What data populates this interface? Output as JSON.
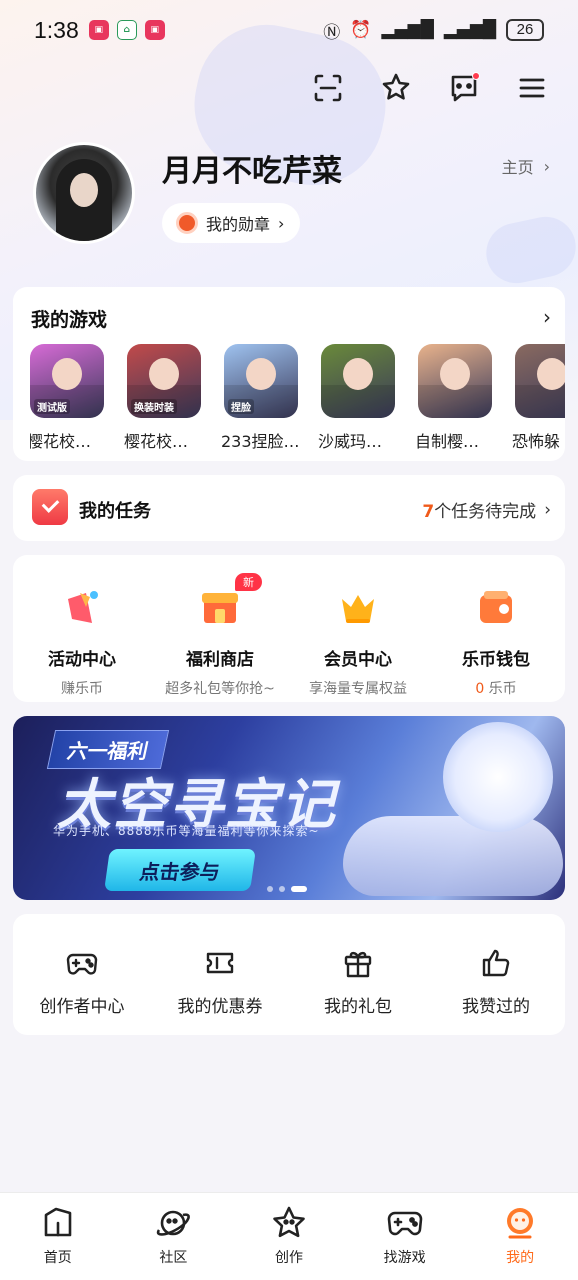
{
  "status_bar": {
    "time": "1:38",
    "battery": "26"
  },
  "profile": {
    "username": "月月不吃芹菜",
    "homepage_label": "主页",
    "medal_label": "我的勋章"
  },
  "my_games": {
    "title": "我的游戏",
    "games": [
      {
        "name": "樱花校…",
        "color": "#d76bd6",
        "tag": "测试版"
      },
      {
        "name": "樱花校…",
        "color": "#c24a4a",
        "tag": "换装时装"
      },
      {
        "name": "233捏脸…",
        "color": "#9fc3f0",
        "tag": "捏脸"
      },
      {
        "name": "沙威玛…",
        "color": "#6a8a3a",
        "tag": ""
      },
      {
        "name": "自制樱…",
        "color": "#e9b38c",
        "tag": ""
      },
      {
        "name": "恐怖躲",
        "color": "#8a6a60",
        "tag": ""
      }
    ]
  },
  "tasks": {
    "title": "我的任务",
    "count": "7",
    "suffix": "个任务待完成"
  },
  "features": [
    {
      "title": "活动中心",
      "sub": "赚乐币",
      "icon": "activity-icon"
    },
    {
      "title": "福利商店",
      "sub": "超多礼包等你抢~",
      "icon": "shop-icon",
      "badge": "新"
    },
    {
      "title": "会员中心",
      "sub": "享海量专属权益",
      "icon": "crown-icon"
    },
    {
      "title": "乐币钱包",
      "sub_num": "0",
      "sub": "乐币",
      "icon": "wallet-icon"
    }
  ],
  "banner": {
    "tag": "六一福利",
    "title": "太空寻宝记",
    "subtitle": "华为手机、8888乐币等海量福利等你来探索~",
    "button": "点击参与",
    "dots": 3,
    "active_dot": 3
  },
  "tools": [
    {
      "label": "创作者中心",
      "icon": "gamepad-icon"
    },
    {
      "label": "我的优惠券",
      "icon": "ticket-icon"
    },
    {
      "label": "我的礼包",
      "icon": "gift-icon"
    },
    {
      "label": "我赞过的",
      "icon": "thumbs-up-icon"
    }
  ],
  "bottom_nav": [
    {
      "label": "首页",
      "icon": "home-icon"
    },
    {
      "label": "社区",
      "icon": "planet-icon"
    },
    {
      "label": "创作",
      "icon": "star-icon"
    },
    {
      "label": "找游戏",
      "icon": "gamepad-icon"
    },
    {
      "label": "我的",
      "icon": "profile-icon",
      "active": true
    }
  ],
  "colors": {
    "accent": "#ff6a1a",
    "badge": "#ff3346",
    "background": "#f5f4f9"
  }
}
